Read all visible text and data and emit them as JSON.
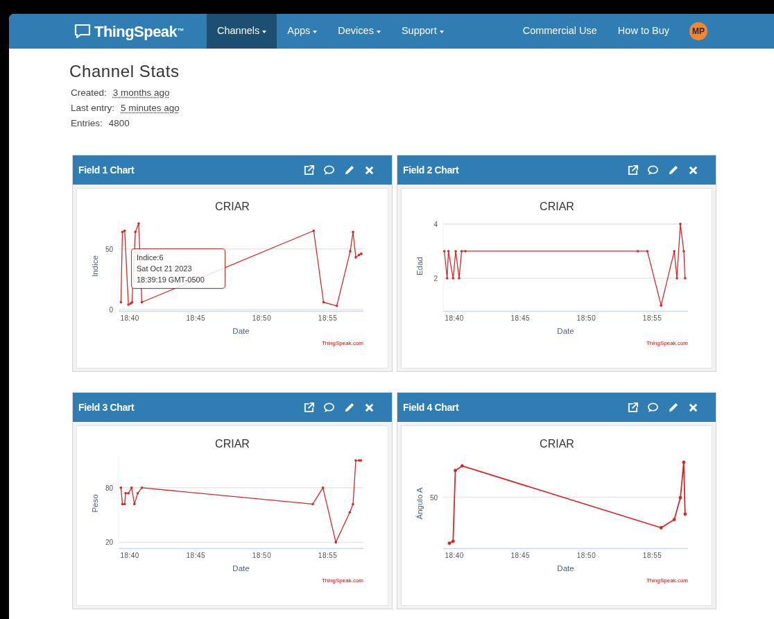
{
  "nav": {
    "logo": "ThingSpeak$^{™}$",
    "items": [
      {
        "label": "Channels",
        "dropdown": true,
        "selected": true
      },
      {
        "label": "Apps",
        "dropdown": true,
        "selected": false
      },
      {
        "label": "Devices",
        "dropdown": true,
        "selected": false
      },
      {
        "label": "Support",
        "dropdown": true,
        "selected": false
      }
    ],
    "right_items": [
      {
        "label": "Commercial Use"
      },
      {
        "label": "How to Buy"
      }
    ],
    "avatar": "MP"
  },
  "stats": {
    "title": "Channel Stats",
    "rows": [
      {
        "label": "Created:",
        "value": "3 months ago",
        "dotted": true
      },
      {
        "label": "Last entry:",
        "value": "5 minutes ago",
        "dotted": true
      },
      {
        "label": "Entries:",
        "value": "4800",
        "dotted": false
      }
    ]
  },
  "panels": [
    {
      "title": "Field 1 Chart",
      "credit": "ThingSpeak.com",
      "chart_data": {
        "type": "line",
        "title": "CRIAR",
        "xlabel": "Date",
        "ylabel": "Indice",
        "x": [
          1119.33,
          1119.44,
          1119.61,
          1119.89,
          1120.07,
          1120.17,
          1120.42,
          1120.67,
          1120.91,
          1133.93,
          1134.68,
          1135.68,
          1136.7,
          1136.91,
          1137.12,
          1137.37,
          1137.54
        ],
        "series": [
          {
            "color": "#d62728",
            "values": [
              6,
              64,
              65,
              4,
              5,
              6,
              64,
              71,
              6,
              65,
              6,
              3,
              48,
              64,
              43,
              45,
              46
            ]
          }
        ],
        "xlim": [
          1119.15,
          1137.7
        ],
        "ylim": [
          0,
          75
        ],
        "xticks": [
          {
            "value": 1120,
            "label": "18:40"
          },
          {
            "value": 1125,
            "label": "18:45"
          },
          {
            "value": 1130,
            "label": "18:50"
          },
          {
            "value": 1135,
            "label": "18:55"
          }
        ],
        "yticks": [
          0,
          50
        ]
      },
      "tooltip": {
        "lines": [
          "Indice:6",
          "Sat Oct 21 2023",
          "18:39:19 GMT-0500"
        ]
      }
    },
    {
      "title": "Field 2 Chart",
      "credit": "ThingSpeak.com",
      "chart_data": {
        "type": "line",
        "title": "CRIAR",
        "xlabel": "Date",
        "ylabel": "Edad",
        "x": [
          1119.24,
          1119.45,
          1119.55,
          1119.9,
          1120.1,
          1120.36,
          1120.55,
          1120.83,
          1133.9,
          1134.62,
          1135.66,
          1136.66,
          1136.86,
          1137.12,
          1137.38,
          1137.48
        ],
        "series": [
          {
            "color": "#d62728",
            "values": [
              3,
              2,
              3,
              2,
              3,
              2,
              3,
              3,
              3,
              3,
              1,
              3,
              2,
              4,
              3,
              2
            ]
          }
        ],
        "xlim": [
          1119.15,
          1137.7
        ],
        "ylim": [
          0.85,
          4.2
        ],
        "xticks": [
          {
            "value": 1120,
            "label": "18:40"
          },
          {
            "value": 1125,
            "label": "18:45"
          },
          {
            "value": 1130,
            "label": "18:50"
          },
          {
            "value": 1135,
            "label": "18:55"
          }
        ],
        "yticks": [
          2,
          4
        ]
      }
    },
    {
      "title": "Field 3 Chart",
      "credit": "ThingSpeak.com",
      "chart_data": {
        "type": "line",
        "title": "CRIAR",
        "xlabel": "Date",
        "ylabel": "Peso",
        "x": [
          1119.33,
          1119.44,
          1119.61,
          1119.68,
          1119.89,
          1120.14,
          1120.35,
          1120.6,
          1120.91,
          1133.86,
          1134.63,
          1135.61,
          1136.67,
          1136.91,
          1137.12,
          1137.37,
          1137.51
        ],
        "series": [
          {
            "color": "#d62728",
            "values": [
              80,
              62,
              62,
              74,
              74,
              80,
              62,
              74,
              80,
              62,
              80,
              20,
              53,
              62,
              110,
              110,
              110
            ]
          }
        ],
        "xlim": [
          1119.15,
          1137.7
        ],
        "ylim": [
          15,
          115
        ],
        "xticks": [
          {
            "value": 1120,
            "label": "18:40"
          },
          {
            "value": 1125,
            "label": "18:45"
          },
          {
            "value": 1130,
            "label": "18:50"
          },
          {
            "value": 1135,
            "label": "18:55"
          }
        ],
        "yticks": [
          20,
          80
        ]
      }
    },
    {
      "title": "Field 4 Chart",
      "credit": "ThingSpeak.com",
      "chart_picture": {
        "title": "CRIAR",
        "xlabel": "Date",
        "ylabel": "Ángulo A",
        "xtick_labels": [
          "18:40",
          "18:45",
          "18:50",
          "18:55"
        ],
        "ytick_labels": [
          "50"
        ]
      }
    }
  ]
}
